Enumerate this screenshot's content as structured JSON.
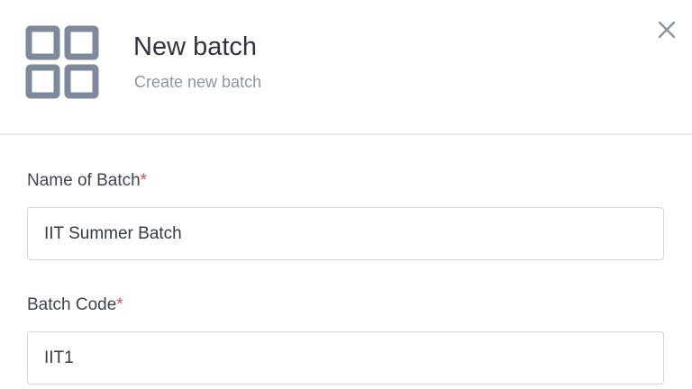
{
  "header": {
    "icon": "grid-icon",
    "title": "New batch",
    "subtitle": "Create new batch",
    "close_icon": "close-icon"
  },
  "form": {
    "fields": [
      {
        "label": "Name of Batch",
        "required_mark": "*",
        "value": "IIT Summer Batch"
      },
      {
        "label": "Batch Code",
        "required_mark": "*",
        "value": "IIT1"
      }
    ]
  },
  "colors": {
    "icon": "#7e8a9c",
    "required": "#e5484d",
    "title": "#2e3440",
    "subtitle": "#8b95a5",
    "input_border": "#cfd6e0"
  }
}
